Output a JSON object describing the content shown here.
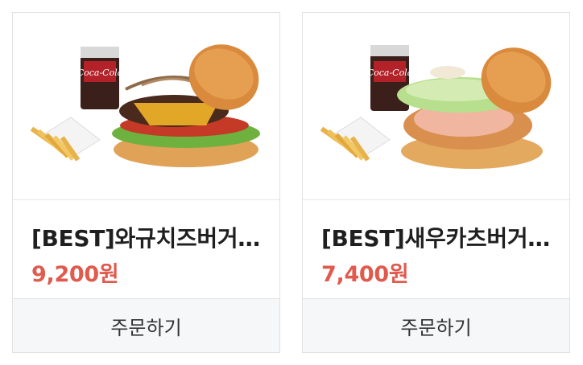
{
  "products": [
    {
      "name": "[BEST]와규치즈버거세트",
      "price": "9,200원",
      "order_label": "주문하기",
      "image_icon": "burger-combo-image"
    },
    {
      "name": "[BEST]새우카츠버거세트",
      "price": "7,400원",
      "order_label": "주문하기",
      "image_icon": "burger-combo-image"
    }
  ],
  "colors": {
    "price": "#e05a4e",
    "button_bg": "#f6f7f9",
    "border": "#e2e2e2"
  }
}
